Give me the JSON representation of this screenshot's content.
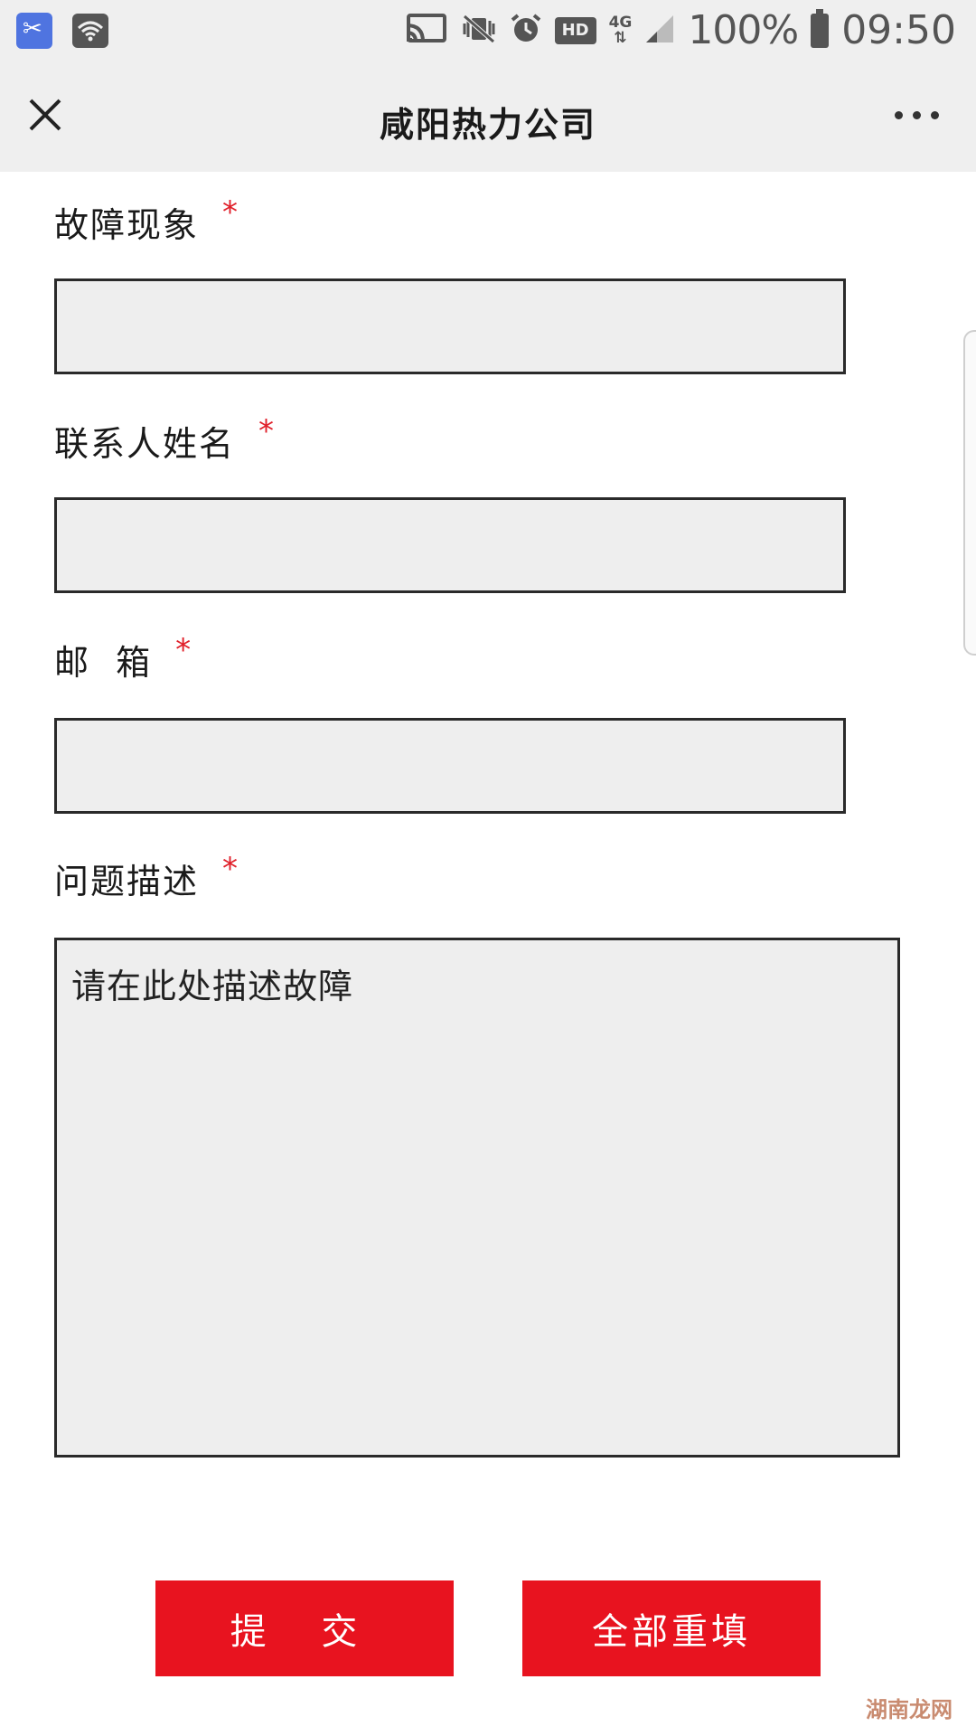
{
  "status_bar": {
    "network_label": "4G",
    "hd_label": "HD",
    "battery_percent": "100%",
    "time": "09:50"
  },
  "header": {
    "title": "咸阳热力公司"
  },
  "form": {
    "fields": [
      {
        "label": "故障现象",
        "required_mark": "*",
        "value": ""
      },
      {
        "label": "联系人姓名",
        "required_mark": "*",
        "value": ""
      },
      {
        "label": "邮 箱",
        "required_mark": "*",
        "value": ""
      }
    ],
    "description": {
      "label": "问题描述",
      "required_mark": "*",
      "value": "请在此处描述故障"
    }
  },
  "buttons": {
    "submit_label": "提 交",
    "reset_label": "全部重填"
  },
  "watermark": "湖南龙网",
  "colors": {
    "accent_red": "#e8131f",
    "required_star": "#e0202a",
    "field_bg": "#eeeeee",
    "header_bg": "#efefef"
  }
}
